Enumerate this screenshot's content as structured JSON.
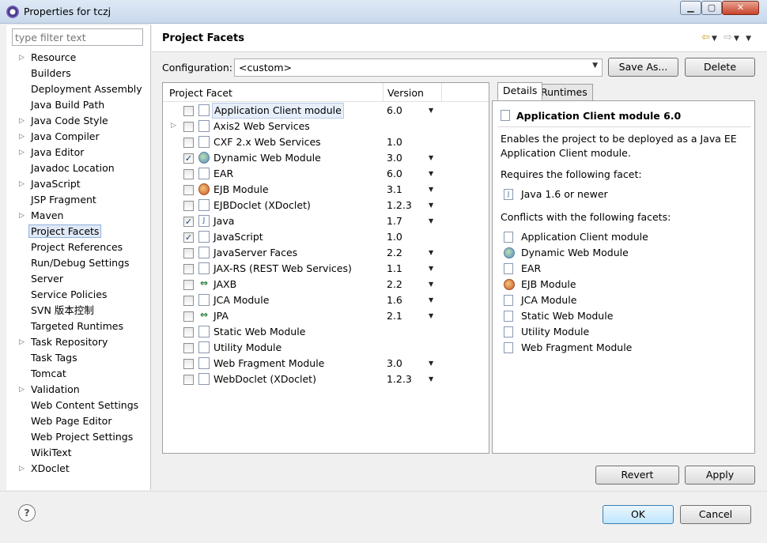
{
  "window": {
    "title": "Properties for tczj",
    "min": "▁",
    "max": "▢",
    "close": "✕"
  },
  "nav": {
    "filter_placeholder": "type filter text",
    "items": [
      {
        "label": "Resource",
        "arrow": "▷"
      },
      {
        "label": "Builders",
        "arrow": ""
      },
      {
        "label": "Deployment Assembly",
        "arrow": ""
      },
      {
        "label": "Java Build Path",
        "arrow": ""
      },
      {
        "label": "Java Code Style",
        "arrow": "▷"
      },
      {
        "label": "Java Compiler",
        "arrow": "▷"
      },
      {
        "label": "Java Editor",
        "arrow": "▷"
      },
      {
        "label": "Javadoc Location",
        "arrow": ""
      },
      {
        "label": "JavaScript",
        "arrow": "▷"
      },
      {
        "label": "JSP Fragment",
        "arrow": ""
      },
      {
        "label": "Maven",
        "arrow": "▷"
      },
      {
        "label": "Project Facets",
        "arrow": ""
      },
      {
        "label": "Project References",
        "arrow": ""
      },
      {
        "label": "Run/Debug Settings",
        "arrow": ""
      },
      {
        "label": "Server",
        "arrow": ""
      },
      {
        "label": "Service Policies",
        "arrow": ""
      },
      {
        "label": "SVN 版本控制",
        "arrow": ""
      },
      {
        "label": "Targeted Runtimes",
        "arrow": ""
      },
      {
        "label": "Task Repository",
        "arrow": "▷"
      },
      {
        "label": "Task Tags",
        "arrow": ""
      },
      {
        "label": "Tomcat",
        "arrow": ""
      },
      {
        "label": "Validation",
        "arrow": "▷"
      },
      {
        "label": "Web Content Settings",
        "arrow": ""
      },
      {
        "label": "Web Page Editor",
        "arrow": ""
      },
      {
        "label": "Web Project Settings",
        "arrow": ""
      },
      {
        "label": "WikiText",
        "arrow": ""
      },
      {
        "label": "XDoclet",
        "arrow": "▷"
      }
    ],
    "selected_index": 11
  },
  "page": {
    "title": "Project Facets",
    "configuration_label": "Configuration:",
    "configuration_value": "<custom>",
    "save_as_label": "Save As...",
    "delete_label": "Delete",
    "revert_label": "Revert",
    "apply_label": "Apply"
  },
  "facets": {
    "col_facet": "Project Facet",
    "col_version": "Version",
    "rows": [
      {
        "name": "Application Client module",
        "version": "6.0",
        "checked": false,
        "dd": true,
        "icon": "page",
        "expander": false
      },
      {
        "name": "Axis2 Web Services",
        "version": "",
        "checked": false,
        "dd": false,
        "icon": "page",
        "expander": true
      },
      {
        "name": "CXF 2.x Web Services",
        "version": "1.0",
        "checked": false,
        "dd": false,
        "icon": "page",
        "expander": false
      },
      {
        "name": "Dynamic Web Module",
        "version": "3.0",
        "checked": true,
        "dd": true,
        "icon": "globe",
        "expander": false
      },
      {
        "name": "EAR",
        "version": "6.0",
        "checked": false,
        "dd": true,
        "icon": "page",
        "expander": false
      },
      {
        "name": "EJB Module",
        "version": "3.1",
        "checked": false,
        "dd": true,
        "icon": "bean",
        "expander": false
      },
      {
        "name": "EJBDoclet (XDoclet)",
        "version": "1.2.3",
        "checked": false,
        "dd": true,
        "icon": "page",
        "expander": false
      },
      {
        "name": "Java",
        "version": "1.7",
        "checked": true,
        "dd": true,
        "icon": "java",
        "expander": false
      },
      {
        "name": "JavaScript",
        "version": "1.0",
        "checked": true,
        "dd": false,
        "icon": "page",
        "expander": false
      },
      {
        "name": "JavaServer Faces",
        "version": "2.2",
        "checked": false,
        "dd": true,
        "icon": "page",
        "expander": false
      },
      {
        "name": "JAX-RS (REST Web Services)",
        "version": "1.1",
        "checked": false,
        "dd": true,
        "icon": "page",
        "expander": false
      },
      {
        "name": "JAXB",
        "version": "2.2",
        "checked": false,
        "dd": true,
        "icon": "arrows",
        "expander": false
      },
      {
        "name": "JCA Module",
        "version": "1.6",
        "checked": false,
        "dd": true,
        "icon": "page",
        "expander": false
      },
      {
        "name": "JPA",
        "version": "2.1",
        "checked": false,
        "dd": true,
        "icon": "arrows",
        "expander": false
      },
      {
        "name": "Static Web Module",
        "version": "",
        "checked": false,
        "dd": false,
        "icon": "page",
        "expander": false
      },
      {
        "name": "Utility Module",
        "version": "",
        "checked": false,
        "dd": false,
        "icon": "page",
        "expander": false
      },
      {
        "name": "Web Fragment Module",
        "version": "3.0",
        "checked": false,
        "dd": true,
        "icon": "page",
        "expander": false
      },
      {
        "name": "WebDoclet (XDoclet)",
        "version": "1.2.3",
        "checked": false,
        "dd": true,
        "icon": "page",
        "expander": false
      }
    ]
  },
  "details": {
    "tab_details": "Details",
    "tab_runtimes": "Runtimes",
    "title": "Application Client module 6.0",
    "description_line1": "Enables the project to be deployed as a Java EE",
    "description_line2": "Application Client module.",
    "requires_label": "Requires the following facet:",
    "requires": [
      {
        "name": "Java 1.6 or newer",
        "icon": "java"
      }
    ],
    "conflicts_label": "Conflicts with the following facets:",
    "conflicts": [
      {
        "name": "Application Client module",
        "icon": "page"
      },
      {
        "name": "Dynamic Web Module",
        "icon": "globe"
      },
      {
        "name": "EAR",
        "icon": "page"
      },
      {
        "name": "EJB Module",
        "icon": "bean"
      },
      {
        "name": "JCA Module",
        "icon": "page"
      },
      {
        "name": "Static Web Module",
        "icon": "page"
      },
      {
        "name": "Utility Module",
        "icon": "page"
      },
      {
        "name": "Web Fragment Module",
        "icon": "page"
      }
    ]
  },
  "footer": {
    "help": "?",
    "ok_label": "OK",
    "cancel_label": "Cancel"
  }
}
